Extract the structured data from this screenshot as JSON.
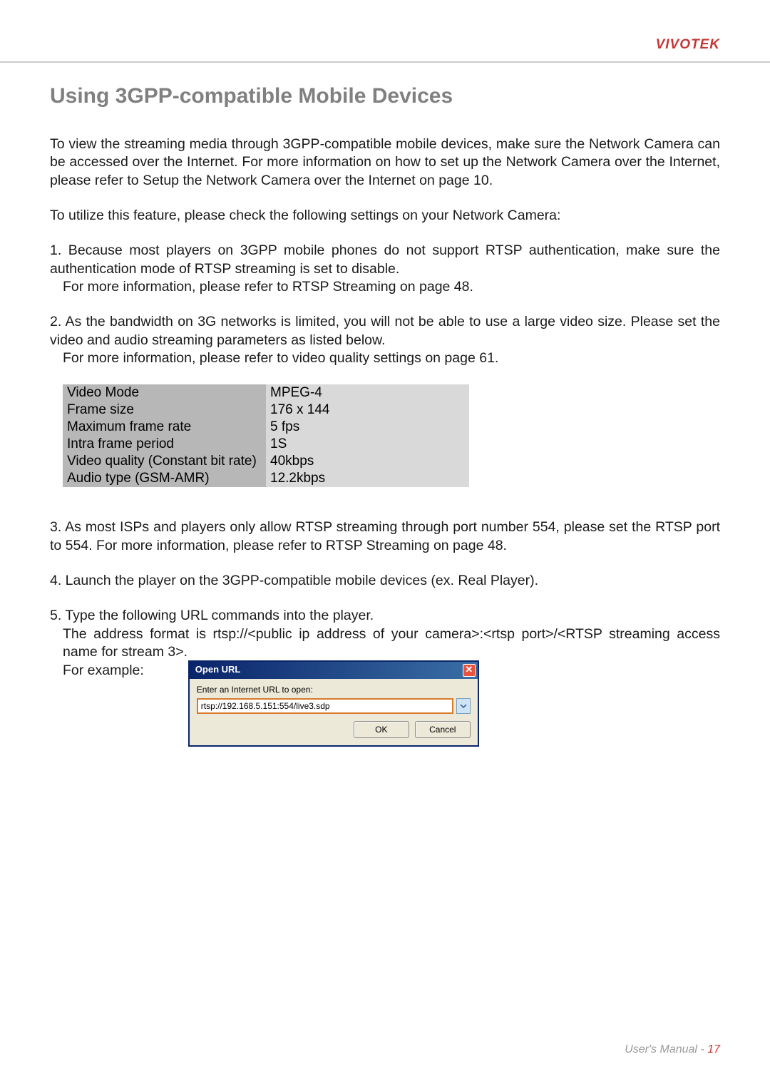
{
  "header": {
    "brand": "VIVOTEK"
  },
  "title": "Using 3GPP-compatible Mobile Devices",
  "para1": "To view the streaming media through 3GPP-compatible mobile devices, make sure the Network Camera can be accessed over the Internet. For more information on how to set up the Network Camera over the Internet, please refer to Setup the Network Camera over the Internet on page 10.",
  "para2": "To utilize this feature, please check the following settings on your Network Camera:",
  "item1_a": "1. Because most players on 3GPP mobile phones do not support RTSP authentication, make sure the authentication mode of RTSP streaming is set to disable.",
  "item1_b": "For more information, please refer to RTSP Streaming on page 48.",
  "item2_a": "2. As the bandwidth on 3G networks is limited, you will not be able to use a large video size. Please set the video and audio streaming parameters as listed below.",
  "item2_b": "For more information, please refer to video quality settings on page 61.",
  "table": [
    {
      "label": "Video Mode",
      "value": "MPEG-4"
    },
    {
      "label": "Frame size",
      "value": "176 x 144"
    },
    {
      "label": "Maximum frame rate",
      "value": "5 fps"
    },
    {
      "label": "Intra frame period",
      "value": "1S"
    },
    {
      "label": "Video quality (Constant bit rate)",
      "value": "40kbps"
    },
    {
      "label": "Audio type (GSM-AMR)",
      "value": "12.2kbps"
    }
  ],
  "item3": "3. As most ISPs and players only allow RTSP streaming through port number 554, please set the RTSP port to 554. For more information, please refer to RTSP Streaming on page 48.",
  "item4": "4. Launch the player on the 3GPP-compatible mobile devices (ex. Real Player).",
  "item5_a": "5. Type the following URL commands into the player.",
  "item5_b": "The address format is rtsp://<public ip address of your camera>:<rtsp port>/<RTSP streaming access name for stream 3>.",
  "item5_c": "For example:",
  "dialog": {
    "title": "Open URL",
    "label": "Enter an Internet URL to open:",
    "value": "rtsp://192.168.5.151:554/live3.sdp",
    "ok": "OK",
    "cancel": "Cancel"
  },
  "footer": {
    "left": "User's Manual - ",
    "page": "17"
  }
}
